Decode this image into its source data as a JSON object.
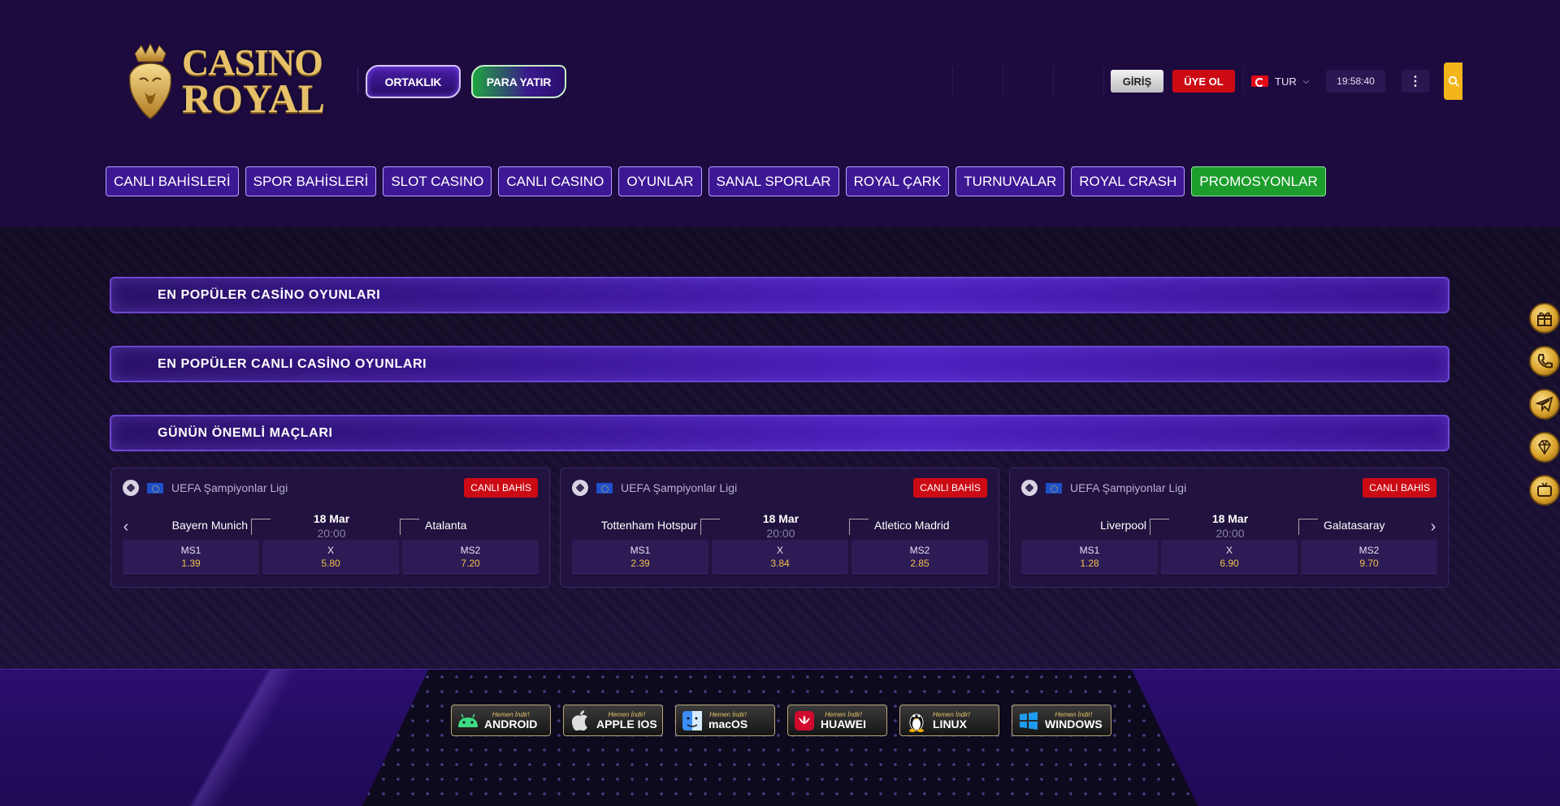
{
  "header": {
    "logo": {
      "line1": "CASINO",
      "line2": "ROYAL"
    },
    "ortaklik_label": "ORTAKLIK",
    "para_yatir_label": "PARA YATIR",
    "giris_label": "GİRİŞ",
    "uye_ol_label": "ÜYE OL",
    "language": "TUR",
    "clock": "19:58:40",
    "kebab": "⋮"
  },
  "nav": {
    "items": [
      "CANLI BAHİSLERİ",
      "SPOR BAHİSLERİ",
      "SLOT CASINO",
      "CANLI CASINO",
      "OYUNLAR",
      "SANAL SPORLAR",
      "ROYAL ÇARK",
      "TURNUVALAR",
      "ROYAL CRASH",
      "PROMOSYONLAR"
    ]
  },
  "sections": {
    "popular_casino": "EN POPÜLER CASİNO OYUNLARI",
    "popular_live_casino": "EN POPÜLER CANLI CASİNO OYUNLARI",
    "todays_matches": "GÜNÜN ÖNEMLİ MAÇLARI"
  },
  "matches": [
    {
      "league": "UEFA Şampiyonlar Ligi",
      "badge": "CANLI BAHİS",
      "home": "Bayern Munich",
      "away": "Atalanta",
      "date": "18 Mar",
      "time": "20:00",
      "odds": [
        {
          "label": "MS1",
          "value": "1.39"
        },
        {
          "label": "X",
          "value": "5.80"
        },
        {
          "label": "MS2",
          "value": "7.20"
        }
      ]
    },
    {
      "league": "UEFA Şampiyonlar Ligi",
      "badge": "CANLI BAHİS",
      "home": "Tottenham Hotspur",
      "away": "Atletico Madrid",
      "date": "18 Mar",
      "time": "20:00",
      "odds": [
        {
          "label": "MS1",
          "value": "2.39"
        },
        {
          "label": "X",
          "value": "3.84"
        },
        {
          "label": "MS2",
          "value": "2.85"
        }
      ]
    },
    {
      "league": "UEFA Şampiyonlar Ligi",
      "badge": "CANLI BAHİS",
      "home": "Liverpool",
      "away": "Galatasaray",
      "date": "18 Mar",
      "time": "20:00",
      "odds": [
        {
          "label": "MS1",
          "value": "1.28"
        },
        {
          "label": "X",
          "value": "6.90"
        },
        {
          "label": "MS2",
          "value": "9.70"
        }
      ]
    }
  ],
  "side_icons": [
    "gift-icon",
    "phone-icon",
    "telegram-icon",
    "diamond-icon",
    "tv-icon"
  ],
  "apps": [
    {
      "small": "Hemen İndir!",
      "name": "ANDROID",
      "icon": "android-icon"
    },
    {
      "small": "Hemen İndir!",
      "name": "APPLE IOS",
      "icon": "apple-icon"
    },
    {
      "small": "Hemen İndir!",
      "name": "macOS",
      "icon": "finder-icon"
    },
    {
      "small": "Hemen İndir!",
      "name": "HUAWEI",
      "icon": "huawei-icon"
    },
    {
      "small": "Hemen İndir!",
      "name": "LINUX",
      "icon": "linux-icon"
    },
    {
      "small": "Hemen İndir!",
      "name": "WINDOWS",
      "icon": "windows-icon"
    }
  ],
  "colors": {
    "brand_gold": "#e6c16a",
    "accent_purple": "#3d1894",
    "promo_green": "#1c9d2c",
    "live_red": "#cc0a14",
    "odds_value": "#f3c24a"
  }
}
